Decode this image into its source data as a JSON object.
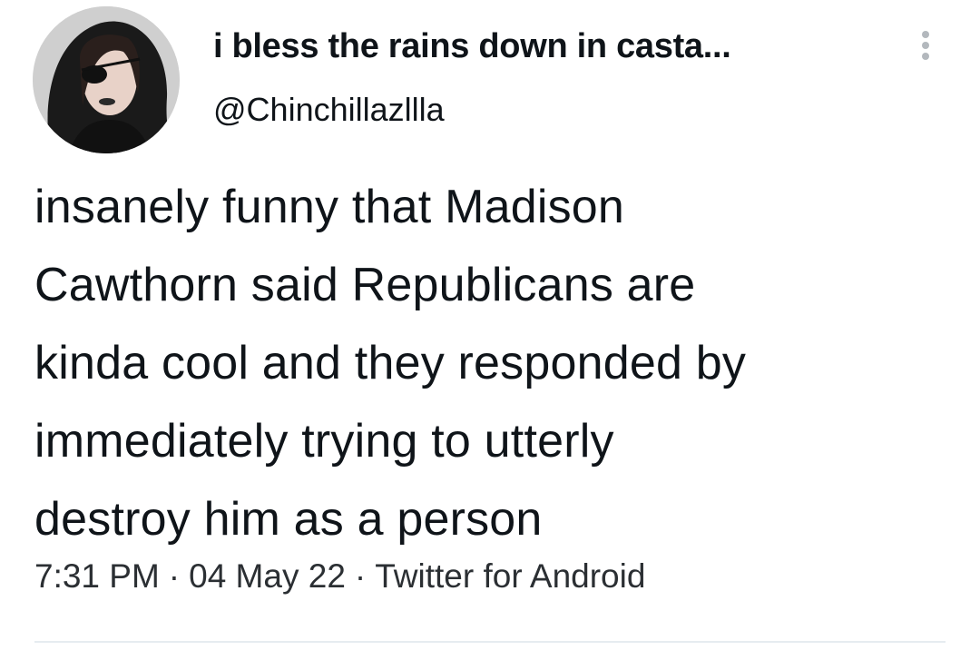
{
  "user": {
    "display_name": "i bless the rains down in casta...",
    "handle": "@Chinchillazllla",
    "avatar_icon": "profile-photo"
  },
  "tweet": {
    "text": "insanely funny that Madison\nCawthorn said Republicans are\nkinda cool and they responded by\nimmediately trying to utterly\ndestroy him as a person"
  },
  "meta": {
    "time": "7:31 PM",
    "date": "04 May 22",
    "source": "Twitter for Android",
    "separator": "·"
  },
  "menu": {
    "icon": "more-options-icon"
  }
}
